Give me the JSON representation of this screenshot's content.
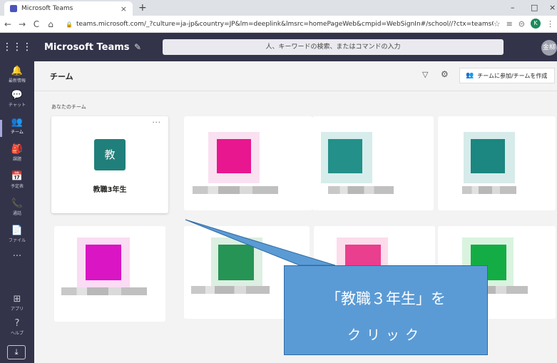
{
  "browser": {
    "tab_title": "Microsoft Teams",
    "tab_close": "×",
    "new_tab": "+",
    "url": "teams.microsoft.com/_?culture=ja-jp&country=JP&lm=deeplink&lmsrc=homePageWeb&cmpid=WebSignIn#/school//?ctx=teamsGrid",
    "profile_initial": "K",
    "window_min": "–",
    "window_max": "□",
    "window_close": "×"
  },
  "teams": {
    "app_name": "Microsoft Teams",
    "search_placeholder": "人、キーワードの検索、またはコマンドの入力",
    "avatar_text": "金柳"
  },
  "rail": {
    "items": [
      {
        "icon": "bell-icon",
        "glyph": "🔔",
        "label": "最新情報"
      },
      {
        "icon": "chat-icon",
        "glyph": "💬",
        "label": "チャット"
      },
      {
        "icon": "teams-icon",
        "glyph": "👥",
        "label": "チーム"
      },
      {
        "icon": "assignments-icon",
        "glyph": "🎒",
        "label": "課題"
      },
      {
        "icon": "calendar-icon",
        "glyph": "📅",
        "label": "予定表"
      },
      {
        "icon": "phone-icon",
        "glyph": "📞",
        "label": "通話"
      },
      {
        "icon": "file-icon",
        "glyph": "📄",
        "label": "ファイル"
      },
      {
        "icon": "more-icon",
        "glyph": "···",
        "label": ""
      },
      {
        "icon": "apps-icon",
        "glyph": "⊞",
        "label": "アプリ"
      },
      {
        "icon": "help-icon",
        "glyph": "?",
        "label": "ヘルプ"
      }
    ],
    "download_glyph": "⤓"
  },
  "main": {
    "title": "チーム",
    "join_button": "チームに参加/チームを作成",
    "section_label": "あなたのチーム",
    "team_card": {
      "tile_letter": "教",
      "name": "教職3年生",
      "more": "···"
    }
  },
  "callout": {
    "line1": "「教職３年生」を",
    "line2": "クリック"
  },
  "colors": {
    "header": "#33344a",
    "team_tile": "#217f7b",
    "callout": "#5b9bd5"
  }
}
